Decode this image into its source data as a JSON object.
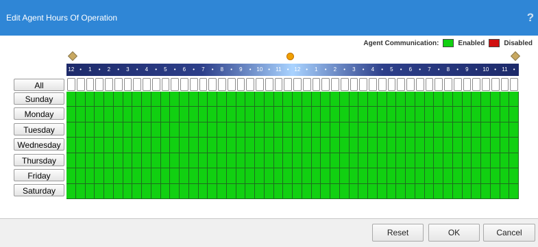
{
  "dialog": {
    "title": "Edit Agent Hours Of Operation",
    "help": "?"
  },
  "legend": {
    "label": "Agent Communication:",
    "enabled": {
      "label": "Enabled",
      "color": "#11d011"
    },
    "disabled": {
      "label": "Disabled",
      "color": "#d01010"
    }
  },
  "hours": {
    "labels": [
      "12",
      "•",
      "1",
      "•",
      "2",
      "•",
      "3",
      "•",
      "4",
      "•",
      "5",
      "•",
      "6",
      "•",
      "7",
      "•",
      "8",
      "•",
      "9",
      "•",
      "10",
      "•",
      "11",
      "•",
      "12",
      "•",
      "1",
      "•",
      "2",
      "•",
      "3",
      "•",
      "4",
      "•",
      "5",
      "•",
      "6",
      "•",
      "7",
      "•",
      "8",
      "•",
      "9",
      "•",
      "10",
      "•",
      "11",
      "•"
    ]
  },
  "rows": {
    "all": "All",
    "days": [
      "Sunday",
      "Monday",
      "Tuesday",
      "Wednesday",
      "Thursday",
      "Friday",
      "Saturday"
    ]
  },
  "schedule_state": "all-enabled",
  "buttons": {
    "reset": "Reset",
    "ok": "OK",
    "cancel": "Cancel"
  }
}
